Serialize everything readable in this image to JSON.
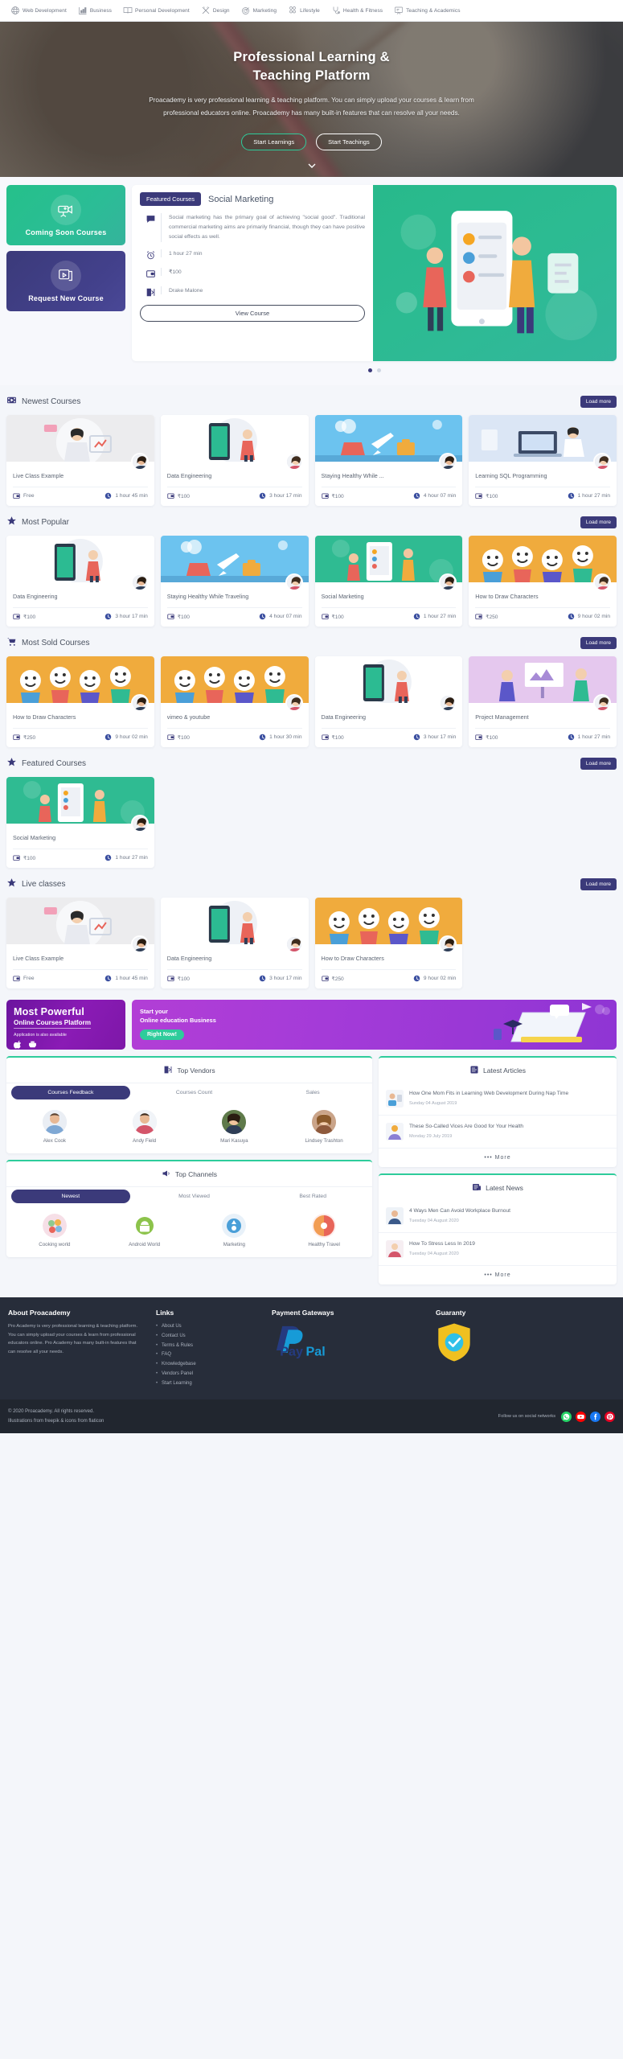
{
  "nav": {
    "items": [
      {
        "label": "Web Development",
        "icon": "globe-icon"
      },
      {
        "label": "Business",
        "icon": "bar-chart-icon"
      },
      {
        "label": "Personal Development",
        "icon": "book-icon"
      },
      {
        "label": "Design",
        "icon": "pencil-ruler-icon"
      },
      {
        "label": "Marketing",
        "icon": "target-icon"
      },
      {
        "label": "Lifestyle",
        "icon": "group-icon"
      },
      {
        "label": "Health & Fitness",
        "icon": "stethoscope-icon"
      },
      {
        "label": "Teaching & Academics",
        "icon": "presentation-icon"
      }
    ]
  },
  "hero": {
    "title_line1": "Professional Learning &",
    "title_line2": "Teaching Platform",
    "paragraph": "Proacademy is very professional learning & teaching platform. You can simply upload your courses & learn from professional educators online. Proacademy has many built-in features that can resolve all your needs.",
    "btn_primary": "Start Learnings",
    "btn_secondary": "Start Teachings",
    "scroll_icon": "chevron-down-icon"
  },
  "featured_tiles": [
    {
      "label": "Coming Soon Courses",
      "icon": "video-camera-icon",
      "color": "#25c08a"
    },
    {
      "label": "Request New Course",
      "icon": "video-play-icon",
      "color": "#3b3a7a"
    }
  ],
  "featured_card": {
    "tab_label": "Featured Courses",
    "course_title": "Social Marketing",
    "description": "Social marketing has the primary goal of achieving \"social good\". Traditional commercial marketing aims are primarily financial, though they can have positive social effects as well.",
    "duration": "1 hour 27 min",
    "price": "₹100",
    "author": "Drake Malone",
    "button": "View Course",
    "icons": {
      "desc": "comment-icon",
      "duration": "alarm-clock-icon",
      "price": "wallet-icon",
      "author": "instructor-icon"
    },
    "dots": [
      true,
      false
    ]
  },
  "sections": [
    {
      "id": "newest-courses",
      "title": "Newest Courses",
      "icon": "film-icon",
      "load_more": "Load more",
      "cards": [
        {
          "name": "Live Class Example",
          "price": "Free",
          "duration": "1 hour 45 min",
          "img": "woman-laptop-illustration",
          "bg": "#ececee"
        },
        {
          "name": "Data Engineering",
          "price": "₹100",
          "duration": "3 hour 17 min",
          "img": "phone-person-illustration",
          "bg": "#ffffff"
        },
        {
          "name": "Staying Healthy While ...",
          "price": "₹100",
          "duration": "4 hour 07 min",
          "img": "travel-illustration",
          "bg": "#6cc3ef"
        },
        {
          "name": "Learning SQL Programming",
          "price": "₹100",
          "duration": "1 hour 27 min",
          "img": "laptop-woman-illustration",
          "bg": "#dbe6f5"
        }
      ]
    },
    {
      "id": "most-popular",
      "title": "Most Popular",
      "icon": "star-icon",
      "load_more": "Load more",
      "cards": [
        {
          "name": "Data Engineering",
          "price": "₹100",
          "duration": "3 hour 17 min",
          "img": "phone-person-illustration",
          "bg": "#ffffff"
        },
        {
          "name": "Staying Healthy While Traveling",
          "price": "₹100",
          "duration": "4 hour 07 min",
          "img": "travel-illustration",
          "bg": "#6cc3ef"
        },
        {
          "name": "Social Marketing",
          "price": "₹100",
          "duration": "1 hour 27 min",
          "img": "social-illustration",
          "bg": "#2fbb92"
        },
        {
          "name": "How to Draw Characters",
          "price": "₹250",
          "duration": "9 hour 02 min",
          "img": "characters-illustration",
          "bg": "#f0ab3d"
        }
      ]
    },
    {
      "id": "most-sold-courses",
      "title": "Most Sold Courses",
      "icon": "cart-icon",
      "load_more": "Load more",
      "cards": [
        {
          "name": "How to Draw Characters",
          "price": "₹250",
          "duration": "9 hour 02 min",
          "img": "characters-illustration",
          "bg": "#f0ab3d"
        },
        {
          "name": "vimeo & youtube",
          "price": "₹100",
          "duration": "1 hour 30 min",
          "img": "characters-illustration",
          "bg": "#f0ab3d"
        },
        {
          "name": "Data Engineering",
          "price": "₹100",
          "duration": "3 hour 17 min",
          "img": "phone-person-illustration",
          "bg": "#ffffff"
        },
        {
          "name": "Project Management",
          "price": "₹100",
          "duration": "1 hour 27 min",
          "img": "presentation-illustration",
          "bg": "#e5c8ee"
        }
      ]
    },
    {
      "id": "featured-courses",
      "title": "Featured Courses",
      "icon": "star-icon",
      "load_more": "Load more",
      "cards": [
        {
          "name": "Social Marketing",
          "price": "₹100",
          "duration": "1 hour 27 min",
          "img": "social-illustration",
          "bg": "#2fbb92"
        }
      ]
    },
    {
      "id": "live-classes",
      "title": "Live classes",
      "icon": "star-icon",
      "load_more": "Load more",
      "cards": [
        {
          "name": "Live Class Example",
          "price": "Free",
          "duration": "1 hour 45 min",
          "img": "woman-laptop-illustration",
          "bg": "#ececee"
        },
        {
          "name": "Data Engineering",
          "price": "₹100",
          "duration": "3 hour 17 min",
          "img": "phone-person-illustration",
          "bg": "#ffffff"
        },
        {
          "name": "How to Draw Characters",
          "price": "₹250",
          "duration": "9 hour 02 min",
          "img": "characters-illustration",
          "bg": "#f0ab3d"
        }
      ]
    }
  ],
  "promo": {
    "left": {
      "line1": "Most Powerful",
      "line2": "Online Courses Platform",
      "line3": "Application is also available",
      "icons": [
        "apple-icon",
        "android-icon"
      ]
    },
    "right": {
      "line1": "Start your",
      "line2": "Online education Business",
      "cta": "Right Now!"
    }
  },
  "top_vendors": {
    "title": "Top Vendors",
    "icon": "vendor-icon",
    "tabs": [
      {
        "label": "Courses Feedback",
        "active": true
      },
      {
        "label": "Courses Count",
        "active": false
      },
      {
        "label": "Sales",
        "active": false
      }
    ],
    "people": [
      {
        "name": "Alex Cook"
      },
      {
        "name": "Andy Field"
      },
      {
        "name": "Mari Kasuya"
      },
      {
        "name": "Lindsey Trashton"
      }
    ]
  },
  "top_channels": {
    "title": "Top Channels",
    "icon": "megaphone-icon",
    "tabs": [
      {
        "label": "Newest",
        "active": true
      },
      {
        "label": "Most Viewed",
        "active": false
      },
      {
        "label": "Best Rated",
        "active": false
      }
    ],
    "channels": [
      {
        "name": "Cooking world",
        "color": "#f3c6d4"
      },
      {
        "name": "Android World",
        "color": "#7cc24a"
      },
      {
        "name": "Marketing",
        "color": "#4a9fd8"
      },
      {
        "name": "Healthy Travel",
        "color": "#e8655a"
      }
    ]
  },
  "latest_articles": {
    "title": "Latest Articles",
    "icon": "article-icon",
    "items": [
      {
        "title": "How One Mom Fits in Learning Web Development During Nap Time",
        "date": "Sunday 04 August 2019"
      },
      {
        "title": "These So-Called Vices Are Good for Your Health",
        "date": "Monday 29 July 2019"
      }
    ],
    "more": "••• More"
  },
  "latest_news": {
    "title": "Latest News",
    "icon": "news-icon",
    "items": [
      {
        "title": "4 Ways Men Can Avoid Workplace Burnout",
        "date": "Tuesday 04 August 2020"
      },
      {
        "title": "How To Stress Less In 2019",
        "date": "Tuesday 04 August 2020"
      }
    ],
    "more": "••• More"
  },
  "footer": {
    "about": {
      "heading": "About Proacademy",
      "text": "Pro Academy is very professional learning & teaching platform. You can simply upload your courses & learn from professional educators online. Pro Academy has many built-in features that can resolve all your needs."
    },
    "links": {
      "heading": "Links",
      "items": [
        "About Us",
        "Contact Us",
        "Terms & Rules",
        "FAQ",
        "Knowledgebase",
        "Vendors Panel",
        "Start Learning"
      ]
    },
    "payment": {
      "heading": "Payment Gateways",
      "logo": "paypal-logo"
    },
    "guaranty": {
      "heading": "Guaranty",
      "logo": "shield-check-icon"
    },
    "sub": {
      "copyright": "© 2020 Proacademy. All rights reserved.",
      "credits": "Illustrations from freepik & icons from flaticon",
      "social_label": "Follow us on social networks",
      "socials": [
        "whatsapp-icon",
        "youtube-icon",
        "facebook-icon",
        "pinterest-icon"
      ]
    }
  }
}
